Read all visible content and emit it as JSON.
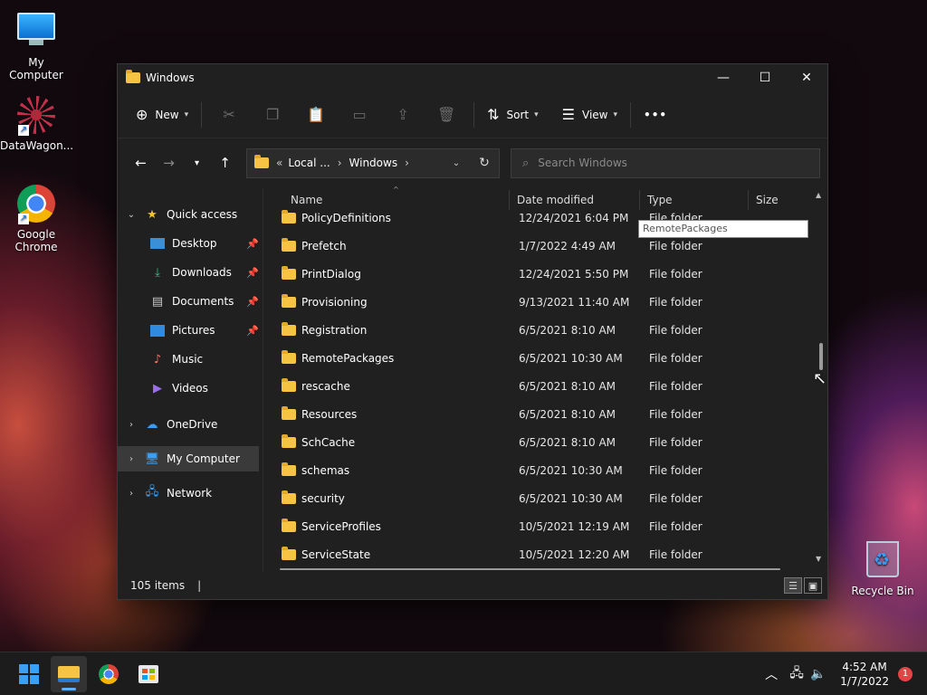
{
  "desktop": {
    "icons": [
      {
        "label": "My Computer"
      },
      {
        "label": "DataWagon..."
      },
      {
        "label": "Google Chrome"
      },
      {
        "label": "Recycle Bin"
      }
    ]
  },
  "window": {
    "title": "Windows",
    "controls": {
      "minimize": "—",
      "maximize": "☐",
      "close": "✕"
    }
  },
  "toolbar": {
    "new_label": "New",
    "sort_label": "Sort",
    "view_label": "View",
    "more_label": "•••"
  },
  "address": {
    "prefix": "«",
    "crumbs": [
      "Local ...",
      "Windows"
    ],
    "search_placeholder": "Search Windows"
  },
  "navpane": {
    "items": [
      {
        "label": "Quick access"
      },
      {
        "label": "Desktop"
      },
      {
        "label": "Downloads"
      },
      {
        "label": "Documents"
      },
      {
        "label": "Pictures"
      },
      {
        "label": "Music"
      },
      {
        "label": "Videos"
      },
      {
        "label": "OneDrive"
      },
      {
        "label": "My Computer"
      },
      {
        "label": "Network"
      }
    ]
  },
  "columns": {
    "name": "Name",
    "date": "Date modified",
    "type": "Type",
    "size": "Size"
  },
  "files": [
    {
      "name": "PolicyDefinitions",
      "date": "12/24/2021 6:04 PM",
      "type": "File folder"
    },
    {
      "name": "Prefetch",
      "date": "1/7/2022 4:49 AM",
      "type": "File folder"
    },
    {
      "name": "PrintDialog",
      "date": "12/24/2021 5:50 PM",
      "type": "File folder"
    },
    {
      "name": "Provisioning",
      "date": "9/13/2021 11:40 AM",
      "type": "File folder"
    },
    {
      "name": "Registration",
      "date": "6/5/2021 8:10 AM",
      "type": "File folder"
    },
    {
      "name": "RemotePackages",
      "date": "6/5/2021 10:30 AM",
      "type": "File folder"
    },
    {
      "name": "rescache",
      "date": "6/5/2021 8:10 AM",
      "type": "File folder"
    },
    {
      "name": "Resources",
      "date": "6/5/2021 8:10 AM",
      "type": "File folder"
    },
    {
      "name": "SchCache",
      "date": "6/5/2021 8:10 AM",
      "type": "File folder"
    },
    {
      "name": "schemas",
      "date": "6/5/2021 10:30 AM",
      "type": "File folder"
    },
    {
      "name": "security",
      "date": "6/5/2021 10:30 AM",
      "type": "File folder"
    },
    {
      "name": "ServiceProfiles",
      "date": "10/5/2021 12:19 AM",
      "type": "File folder"
    },
    {
      "name": "ServiceState",
      "date": "10/5/2021 12:20 AM",
      "type": "File folder"
    }
  ],
  "tooltip": "RemotePackages",
  "status": {
    "items_count": "105 items",
    "cursor": "|"
  },
  "taskbar": {
    "clock_time": "4:52 AM",
    "clock_date": "1/7/2022",
    "notification_count": "1"
  }
}
